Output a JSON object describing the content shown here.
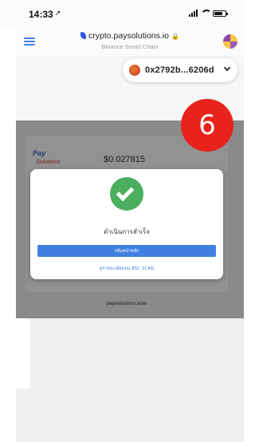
{
  "status_bar": {
    "time": "14:33",
    "location_arrow": "location-arrow-icon"
  },
  "browser": {
    "url": "crypto.paysolutions.io",
    "chain": "Binance Smart Chain"
  },
  "wallet": {
    "address": "0x2792b...6206d"
  },
  "payment_card": {
    "logo_line1": "Pay",
    "logo_line2": "Solutions",
    "price": "$0.027815",
    "domain": "paysolutions.asia"
  },
  "step_badge": {
    "number": "6",
    "color": "#e8231c"
  },
  "success_modal": {
    "message": "ดำเนินการสำเร็จ",
    "primary_button": "กลับหน้าหลัก",
    "explorer_link": "ดูรายละเอียดบน BSC SCAN",
    "check_color": "#4cae5f",
    "button_color": "#3f7fe0"
  }
}
